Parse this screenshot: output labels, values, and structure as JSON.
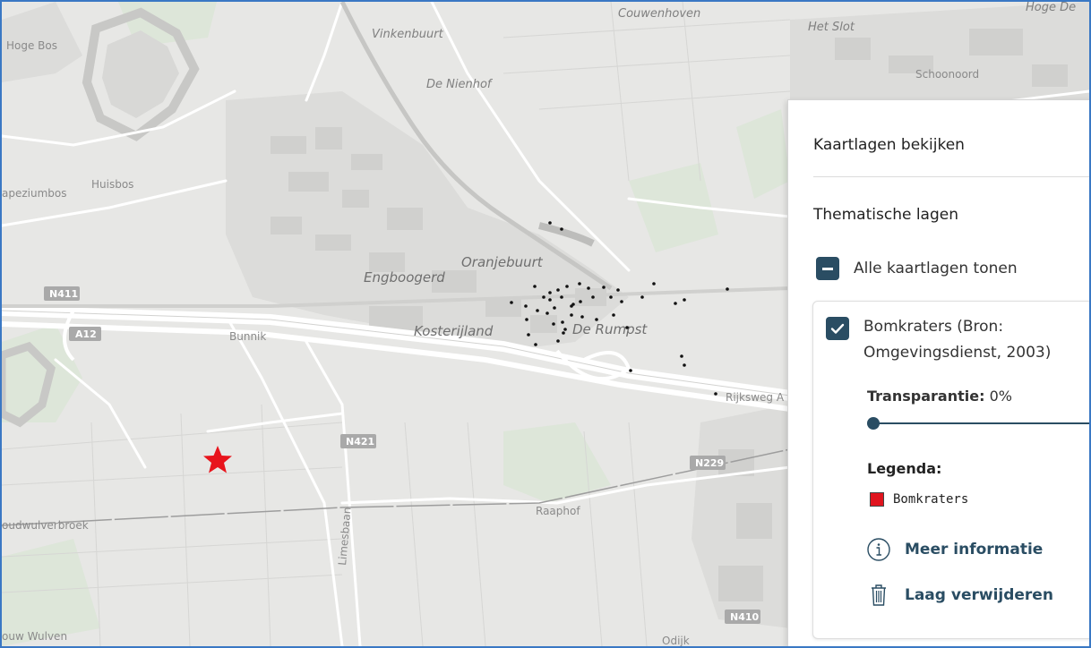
{
  "map": {
    "places": {
      "couwenhoven": "Couwenhoven",
      "vinkenbuurt": "Vinkenbuurt",
      "het_slot": "Het Slot",
      "hoge_de": "Hoge De",
      "hoge_bos": "Hoge Bos",
      "schoonoord": "Schoonoord",
      "de_nienhof": "De Nienhof",
      "huisbos": "Huisbos",
      "apeziumbos": "apeziumbos",
      "oranjebuurt": "Oranjebuurt",
      "engboogerd": "Engboogerd",
      "kosterijland": "Kosterijland",
      "de_rumpst": "De Rumpst",
      "bunnik": "Bunnik",
      "rijksweg": "Rijksweg A",
      "raaphof": "Raaphof",
      "limesbaan": "Limesbaan",
      "oudwulverbroek": "oudwulverbroek",
      "ouw_wulven": "ouw Wulven",
      "odijk": "Odijk"
    },
    "roads": {
      "n411": "N411",
      "a12": "A12",
      "n421": "N421",
      "n229": "N229",
      "n410": "N410"
    },
    "marker_icon": "star-marker-icon",
    "marker_color": "#e8141c",
    "crater_color": "#111111"
  },
  "panel": {
    "title": "Kaartlagen bekijken",
    "section_title": "Thematische lagen",
    "all_layers_label": "Alle kaartlagen tonen",
    "layer": {
      "name": "Bomkraters (Bron: Omgevingsdienst, 2003)",
      "transparency_label": "Transparantie:",
      "transparency_value": "0%",
      "transparency_fraction": 0,
      "legend_title": "Legenda:",
      "legend_items": [
        {
          "label": "Bomkraters",
          "color": "#e0141e"
        }
      ],
      "more_info_label": "Meer informatie",
      "remove_label": "Laag verwijderen"
    }
  },
  "colors": {
    "accent": "#2a4d63",
    "frame_border": "#3a78c4"
  }
}
